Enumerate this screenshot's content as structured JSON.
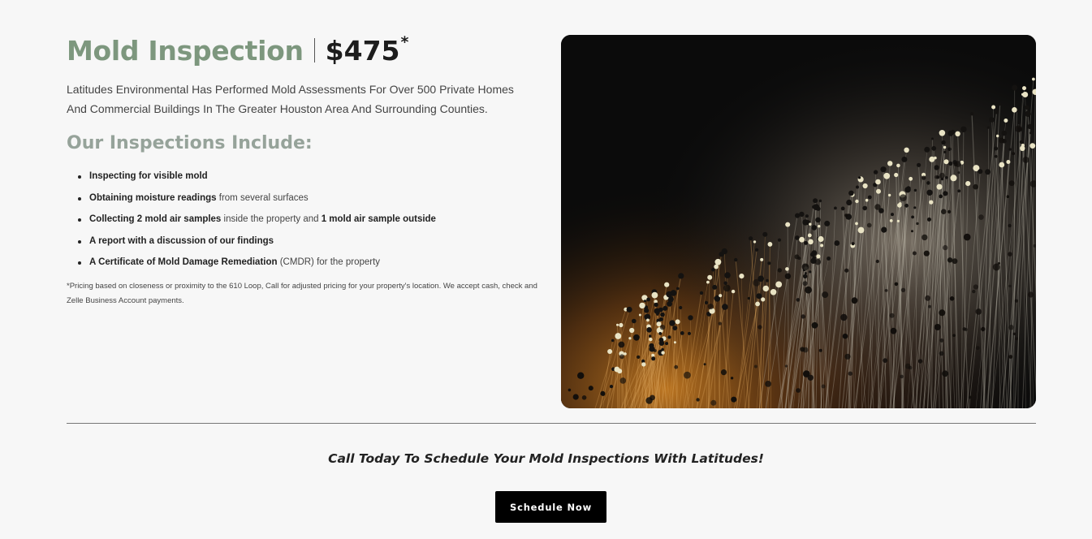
{
  "header": {
    "title": "Mold Inspection",
    "price": "$475",
    "price_mark": "*"
  },
  "intro": "Latitudes Environmental Has Performed Mold Assessments For Over 500 Private Homes And Commercial Buildings In The Greater Houston Area And Surrounding Counties.",
  "inspections": {
    "heading": "Our Inspections Include:",
    "items": [
      {
        "bold": "Inspecting for visible mold",
        "rest": ""
      },
      {
        "bold": "Obtaining moisture readings",
        "rest": " from several surfaces"
      },
      {
        "bold": "Collecting 2 mold air samples",
        "rest": " inside the property and ",
        "bold2": "1 mold air sample outside"
      },
      {
        "bold": "A report with a discussion of our findings",
        "rest": ""
      },
      {
        "bold": "A Certificate of Mold Damage Remediation",
        "rest": " (CMDR) for the property"
      }
    ]
  },
  "footnote": "*Pricing based on closeness or proximity to the 610 Loop, Call for adjusted pricing for your property's location. We accept cash, check and Zelle Business Account payments.",
  "cta": {
    "text": "Call Today To Schedule Your Mold Inspections With Latitudes!",
    "button_label": "Schedule Now"
  },
  "colors": {
    "title_green": "#7d977e",
    "subhead_gray": "#96a39a",
    "button_bg": "#000000",
    "page_bg": "#f7f7f7"
  }
}
